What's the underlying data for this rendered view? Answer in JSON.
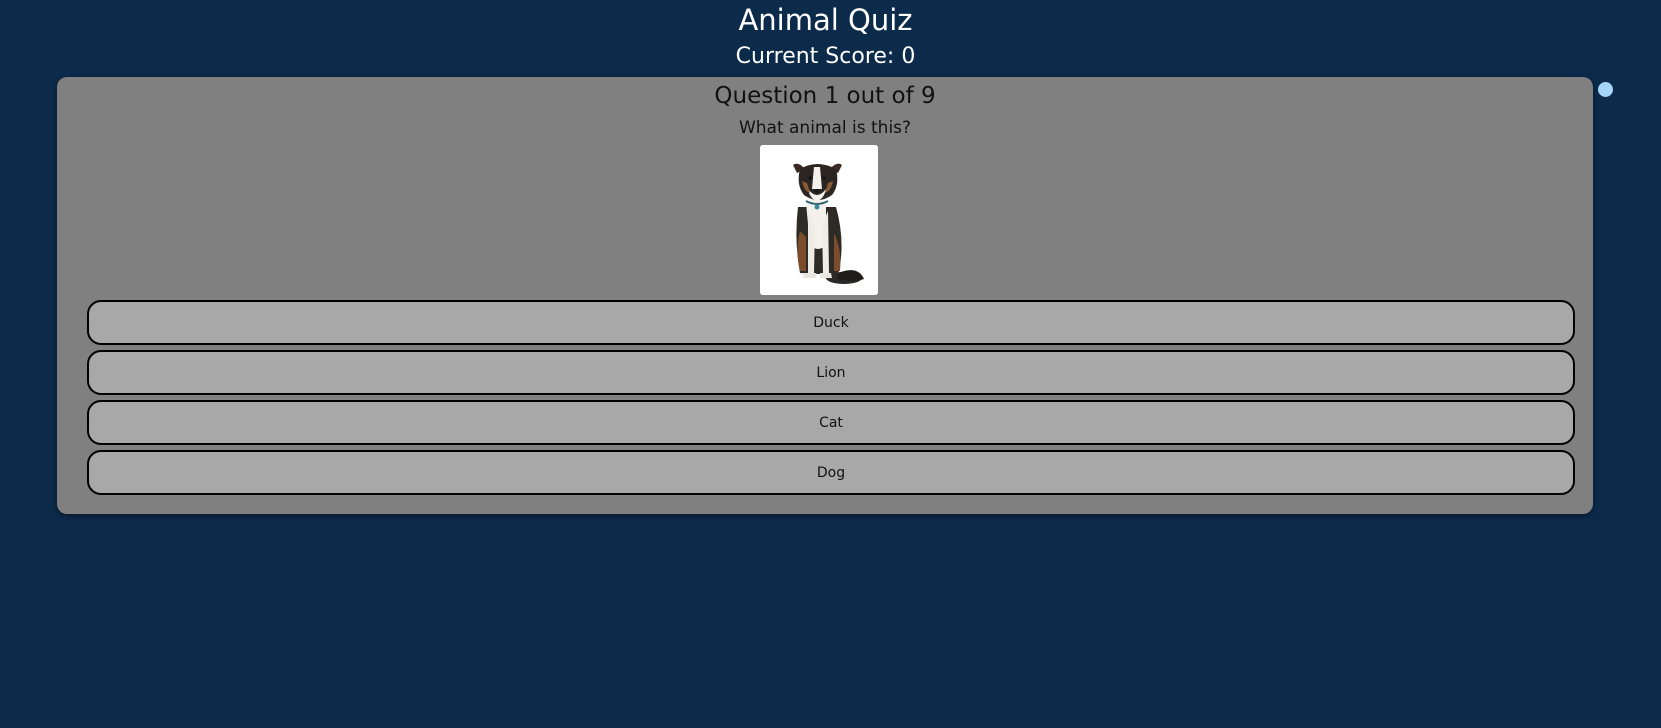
{
  "header": {
    "title": "Animal Quiz",
    "score_label": "Current Score: 0"
  },
  "question": {
    "progress": "Question 1 out of 9",
    "prompt": "What animal is this?",
    "image_alt": "dog photo"
  },
  "options": [
    {
      "label": "Duck"
    },
    {
      "label": "Lion"
    },
    {
      "label": "Cat"
    },
    {
      "label": "Dog"
    }
  ],
  "colors": {
    "background": "#0c2a4a",
    "card": "#808080",
    "option": "#a8a8a8",
    "dot": "#a6d4fb"
  }
}
